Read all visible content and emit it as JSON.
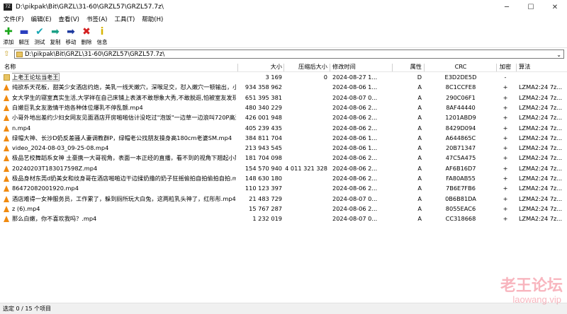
{
  "window": {
    "app_icon_text": "7Z",
    "title": "D:\\pikpak\\Bit\\GRZL\\31-60\\GRZL57\\GRZL57.7z\\"
  },
  "menu": [
    "文件(F)",
    "编辑(E)",
    "查看(V)",
    "书签(A)",
    "工具(T)",
    "帮助(H)"
  ],
  "toolbar": [
    {
      "label": "添加",
      "icon": "plus-icon",
      "glyph": "✚",
      "color": "#1aa61a",
      "name": "add"
    },
    {
      "label": "解压",
      "icon": "minus-icon",
      "glyph": "▬",
      "color": "#2a3fbf",
      "name": "extract"
    },
    {
      "label": "测试",
      "icon": "check-icon",
      "glyph": "✔",
      "color": "#18a7b5",
      "name": "test"
    },
    {
      "label": "复制",
      "icon": "copy-arrow-icon",
      "glyph": "➡",
      "color": "#1aa086",
      "name": "copy"
    },
    {
      "label": "移动",
      "icon": "move-arrow-icon",
      "glyph": "➡",
      "color": "#1d3a9e",
      "name": "move"
    },
    {
      "label": "删除",
      "icon": "delete-x-icon",
      "glyph": "✖",
      "color": "#d42020",
      "name": "delete"
    },
    {
      "label": "信息",
      "icon": "info-icon",
      "glyph": "i",
      "color": "#d8b400",
      "name": "info"
    }
  ],
  "address": {
    "value": "D:\\pikpak\\Bit\\GRZL\\31-60\\GRZL57\\GRZL57.7z\\"
  },
  "columns": {
    "name": "名称",
    "size": "大小",
    "packed": "压缩后大小",
    "modified": "修改时间",
    "attr": "属性",
    "crc": "CRC",
    "encrypted": "加密",
    "method": "算法"
  },
  "files": [
    {
      "name": "上老王论坛当老王",
      "type": "folder",
      "size": "3 169",
      "packed": "0",
      "modified": "2024-08-27 1...",
      "attr": "D",
      "crc": "E3D2DE5D",
      "enc": "-",
      "method": ""
    },
    {
      "name": "纯欲系天花板，甜美少女酒店约炮，美乳一线天嫩穴，深喉足交，怼入嫩穴一顿输出，小...",
      "type": "video",
      "size": "934 358 962",
      "packed": "",
      "modified": "2024-08-06 1...",
      "attr": "A",
      "crc": "8C1CCFE8",
      "enc": "+",
      "method": "LZMA2:24 7z..."
    },
    {
      "name": "女大学生的寝室真实生活,大学祥在自己床铺上表演不敢想象大秀,不敢脱逛,怕被室友发现...",
      "type": "video",
      "size": "651 395 381",
      "packed": "",
      "modified": "2024-08-07 0...",
      "attr": "A",
      "crc": "290C06F1",
      "enc": "+",
      "method": "LZMA2:24 7z..."
    },
    {
      "name": "白嫩巨乳女友激情干炮各种体位爆乳不停乱颤.mp4",
      "type": "video",
      "size": "480 340 229",
      "packed": "",
      "modified": "2024-08-06 2...",
      "attr": "A",
      "crc": "8AF44440",
      "enc": "+",
      "method": "LZMA2:24 7z..."
    },
    {
      "name": "小哥外地出差约少妇女网友见面酒店开房啪啪估计没吃过\"泡饭\"一边草一边浪叫720P高清...",
      "type": "video",
      "size": "426 001 948",
      "packed": "",
      "modified": "2024-08-06 2...",
      "attr": "A",
      "crc": "1201ABD9",
      "enc": "+",
      "method": "LZMA2:24 7z..."
    },
    {
      "name": "n.mp4",
      "type": "video",
      "size": "405 239 435",
      "packed": "",
      "modified": "2024-08-06 2...",
      "attr": "A",
      "crc": "8429D094",
      "enc": "+",
      "method": "LZMA2:24 7z..."
    },
    {
      "name": "绿帽大神、长沙D奶反差骚人妻调教群P，绿帽老公找朋友操身高180cm老婆SM.mp4",
      "type": "video",
      "size": "384 811 704",
      "packed": "",
      "modified": "2024-08-06 1...",
      "attr": "A",
      "crc": "A644865C",
      "enc": "+",
      "method": "LZMA2:24 7z..."
    },
    {
      "name": "video_2024-08-03_09-25-08.mp4",
      "type": "video",
      "size": "213 943 545",
      "packed": "",
      "modified": "2024-08-06 1...",
      "attr": "A",
      "crc": "20B71347",
      "enc": "+",
      "method": "LZMA2:24 7z..."
    },
    {
      "name": "极品艺校舞蹈系女神 土豪携一大哥视角，表面一本正经的直播，看不到的视角下翘起小翘...",
      "type": "video",
      "size": "181 704 098",
      "packed": "",
      "modified": "2024-08-06 2...",
      "attr": "A",
      "crc": "47C5A475",
      "enc": "+",
      "method": "LZMA2:24 7z..."
    },
    {
      "name": "20240203T183017598Z.mp4",
      "type": "video",
      "size": "154 570 940",
      "packed": "4 011 321 328",
      "modified": "2024-08-06 2...",
      "attr": "A",
      "crc": "AF6B16D7",
      "enc": "+",
      "method": "LZMA2:24 7z..."
    },
    {
      "name": "极品身材东莞d奶美女和纹身哥在酒店啪啪边干边揉奶撸的奶子狂摇偷拍自拍偷拍自拍.mp4",
      "type": "video",
      "size": "148 630 180",
      "packed": "",
      "modified": "2024-08-06 2...",
      "attr": "A",
      "crc": "FA80AB55",
      "enc": "+",
      "method": "LZMA2:24 7z..."
    },
    {
      "name": "864720820019​20.mp4",
      "type": "video",
      "size": "110 123 397",
      "packed": "",
      "modified": "2024-08-06 2...",
      "attr": "A",
      "crc": "7B6E7FB6",
      "enc": "+",
      "method": "LZMA2:24 7z..."
    },
    {
      "name": "酒店难得一女神服务员，工作累了，躲到厕所玩大白兔，这两粒乳头神了，红彤彤.mp4",
      "type": "video",
      "size": "21 483 729",
      "packed": "",
      "modified": "2024-08-07 0...",
      "attr": "A",
      "crc": "0B6B81DA",
      "enc": "+",
      "method": "LZMA2:24 7z..."
    },
    {
      "name": "z (6).mp4",
      "type": "video",
      "size": "15 767 287",
      "packed": "",
      "modified": "2024-08-06 2...",
      "attr": "A",
      "crc": "8055EAC6",
      "enc": "+",
      "method": "LZMA2:24 7z..."
    },
    {
      "name": "那么白嫩，你不喜欢我吗？.mp4",
      "type": "video",
      "size": "1 232 019",
      "packed": "",
      "modified": "2024-08-07 0...",
      "attr": "A",
      "crc": "CC318668",
      "enc": "+",
      "method": "LZMA2:24 7z..."
    }
  ],
  "status": {
    "text": "选定 0 / 15 个项目"
  },
  "watermark": {
    "main": "老王论坛",
    "sub": "laowang.vip"
  }
}
